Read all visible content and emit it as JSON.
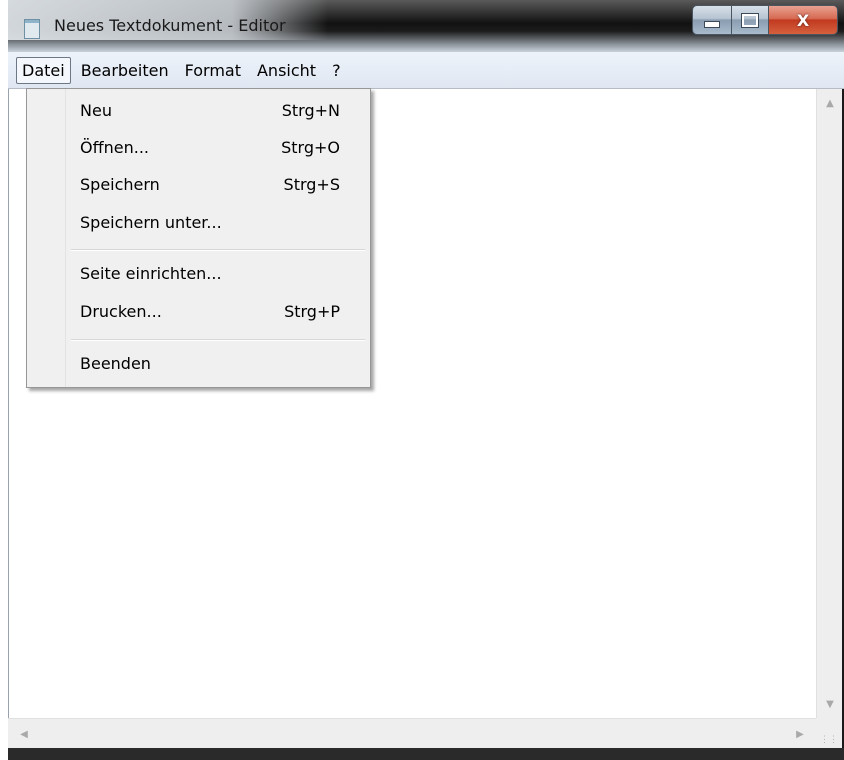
{
  "window": {
    "title": "Neues Textdokument - Editor",
    "icon": "notepad-icon"
  },
  "title_buttons": {
    "minimize": "minimize-icon",
    "maximize": "maximize-icon",
    "close_glyph": "X"
  },
  "menubar": {
    "items": [
      "Datei",
      "Bearbeiten",
      "Format",
      "Ansicht",
      "?"
    ],
    "active": "Datei"
  },
  "file_menu": {
    "items": [
      {
        "label": "Neu",
        "shortcut": "Strg+N"
      },
      {
        "label": "Öffnen...",
        "shortcut": "Strg+O"
      },
      {
        "label": "Speichern",
        "shortcut": "Strg+S"
      },
      {
        "label": "Speichern unter...",
        "shortcut": ""
      },
      {
        "label": "Seite einrichten...",
        "shortcut": ""
      },
      {
        "label": "Drucken...",
        "shortcut": "Strg+P"
      },
      {
        "label": "Beenden",
        "shortcut": ""
      }
    ]
  },
  "editor": {
    "content": ""
  },
  "scrollbars": {
    "up_arrow": "▲",
    "down_arrow": "▼",
    "left_arrow": "◀",
    "right_arrow": "▶"
  },
  "colors": {
    "close_button": "#c13a20",
    "menu_background": "#f0f0f0",
    "menubar_background": "#dfe7f2"
  }
}
